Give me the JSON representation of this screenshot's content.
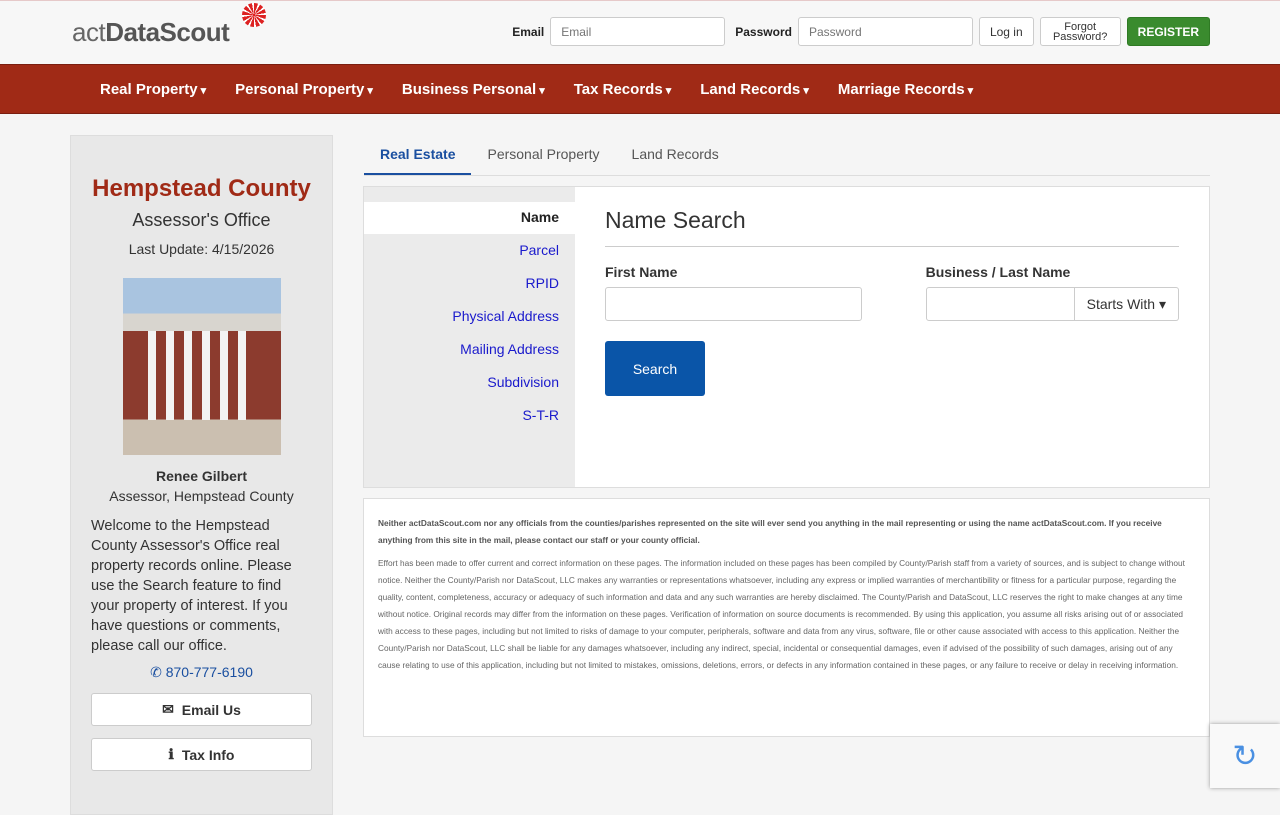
{
  "logo": {
    "text_a": "act",
    "text_b": "DataScout"
  },
  "login": {
    "email_label": "Email",
    "email_placeholder": "Email",
    "password_label": "Password",
    "password_placeholder": "Password",
    "login": "Log in",
    "forgot": "Forgot Password?",
    "register": "REGISTER"
  },
  "nav": [
    "Real Property",
    "Personal Property",
    "Business Personal",
    "Tax Records",
    "Land Records",
    "Marriage Records"
  ],
  "sidebar": {
    "county": "Hempstead County",
    "office": "Assessor's Office",
    "last_update": "Last Update: 4/15/2026",
    "assessor": "Renee Gilbert",
    "title": "Assessor, Hempstead County",
    "welcome": "Welcome to the Hempstead County Assessor's Office real property records online. Please use the Search feature to find your property of interest. If you have questions or comments, please call our office.",
    "phone": "870-777-6190",
    "email_btn": "Email Us",
    "tax_btn": "Tax Info"
  },
  "tabs": [
    "Real Estate",
    "Personal Property",
    "Land Records"
  ],
  "search_types": [
    "Name",
    "Parcel",
    "RPID",
    "Physical Address",
    "Mailing Address",
    "Subdivision",
    "S-T-R"
  ],
  "form": {
    "title": "Name Search",
    "first_label": "First Name",
    "last_label": "Business / Last Name",
    "mode": "Starts With",
    "search": "Search"
  },
  "disclaimer": {
    "notice": "Neither actDataScout.com nor any officials from the counties/parishes represented on the site will ever send you anything in the mail representing or using the name actDataScout.com. If you receive anything from this site in the mail, please contact our staff or your county official.",
    "body": "Effort has been made to offer current and correct information on these pages. The information included on these pages has been compiled by County/Parish staff from a variety of sources, and is subject to change without notice. Neither the County/Parish nor DataScout, LLC makes any warranties or representations whatsoever, including any express or implied warranties of merchantibility or fitness for a particular purpose, regarding the quality, content, completeness, accuracy or adequacy of such information and data and any such warranties are hereby disclaimed. The County/Parish and DataScout, LLC reserves the right to make changes at any time without notice. Original records may differ from the information on these pages. Verification of information on source documents is recommended. By using this application, you assume all risks arising out of or associated with access to these pages, including but not limited to risks of damage to your computer, peripherals, software and data from any virus, software, file or other cause associated with access to this application. Neither the County/Parish nor DataScout, LLC shall be liable for any damages whatsoever, including any indirect, special, incidental or consequential damages, even if advised of the possibility of such damages, arising out of any cause relating to use of this application, including but not limited to mistakes, omissions, deletions, errors, or defects in any information contained in these pages, or any failure to receive or delay in receiving information."
  }
}
